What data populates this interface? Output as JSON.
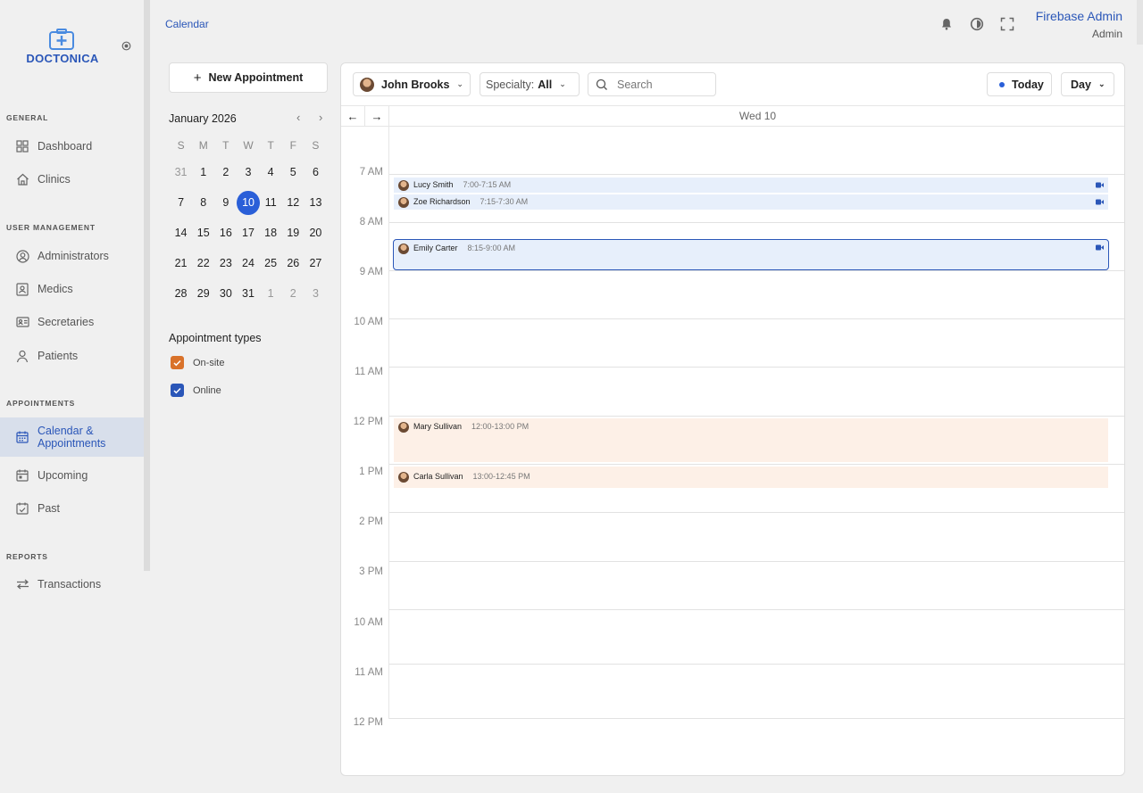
{
  "brand": {
    "name": "DOCTONICA"
  },
  "sidebar": {
    "sections": [
      {
        "title": "GENERAL",
        "items": [
          {
            "label": "Dashboard",
            "icon": "grid-icon"
          },
          {
            "label": "Clinics",
            "icon": "home-icon"
          }
        ]
      },
      {
        "title": "USER MANAGEMENT",
        "items": [
          {
            "label": "Administrators",
            "icon": "user-circle-icon"
          },
          {
            "label": "Medics",
            "icon": "id-badge-icon"
          },
          {
            "label": "Secretaries",
            "icon": "id-card-icon"
          },
          {
            "label": "Patients",
            "icon": "user-icon"
          }
        ]
      },
      {
        "title": "APPOINTMENTS",
        "items": [
          {
            "label": "Calendar & Appointments",
            "icon": "calendar-icon",
            "active": true
          },
          {
            "label": "Upcoming",
            "icon": "calendar-icon"
          },
          {
            "label": "Past",
            "icon": "calendar-check-icon"
          }
        ]
      },
      {
        "title": "REPORTS",
        "items": [
          {
            "label": "Transactions",
            "icon": "transfer-icon"
          }
        ]
      }
    ]
  },
  "header": {
    "breadcrumb": "Calendar",
    "user_name": "Firebase Admin",
    "user_role": "Admin"
  },
  "new_appointment_label": "New Appointment",
  "mini_calendar": {
    "month": "January 2026",
    "weekdays": [
      "S",
      "M",
      "T",
      "W",
      "T",
      "F",
      "S"
    ],
    "weeks": [
      [
        "31",
        "1",
        "2",
        "3",
        "4",
        "5",
        "6"
      ],
      [
        "7",
        "8",
        "9",
        "10",
        "11",
        "12",
        "13"
      ],
      [
        "14",
        "15",
        "16",
        "17",
        "18",
        "19",
        "20"
      ],
      [
        "21",
        "22",
        "23",
        "24",
        "25",
        "26",
        "27"
      ],
      [
        "28",
        "29",
        "30",
        "31",
        "1",
        "2",
        "3"
      ]
    ],
    "selected": "10"
  },
  "appointment_types": {
    "title": "Appointment types",
    "items": [
      {
        "label": "On-site",
        "color": "#d9722a",
        "checked": true
      },
      {
        "label": "Online",
        "color": "#2a56b8",
        "checked": true
      }
    ]
  },
  "toolbar": {
    "medic": "John Brooks",
    "specialty_label": "Specialty:",
    "specialty_value": "All",
    "search_placeholder": "Search",
    "today": "Today",
    "view": "Day"
  },
  "day_header": "Wed  10",
  "hours": [
    "7 AM",
    "8 AM",
    "9 AM",
    "10 AM",
    "11 AM",
    "12 PM",
    "1 PM",
    "2 PM",
    "3 PM",
    "10 AM",
    "11 AM",
    "12 PM"
  ],
  "events": [
    {
      "name": "Lucy Smith",
      "time": "7:00-7:15 AM",
      "type": "online"
    },
    {
      "name": "Zoe Richardson",
      "time": "7:15-7:30 AM",
      "type": "online"
    },
    {
      "name": "Emily Carter",
      "time": "8:15-9:00 AM",
      "type": "online",
      "selected": true
    },
    {
      "name": "Mary Sullivan",
      "time": "12:00-13:00 PM",
      "type": "onsite"
    },
    {
      "name": "Carla Sullivan",
      "time": "13:00-12:45 PM",
      "type": "onsite"
    }
  ]
}
